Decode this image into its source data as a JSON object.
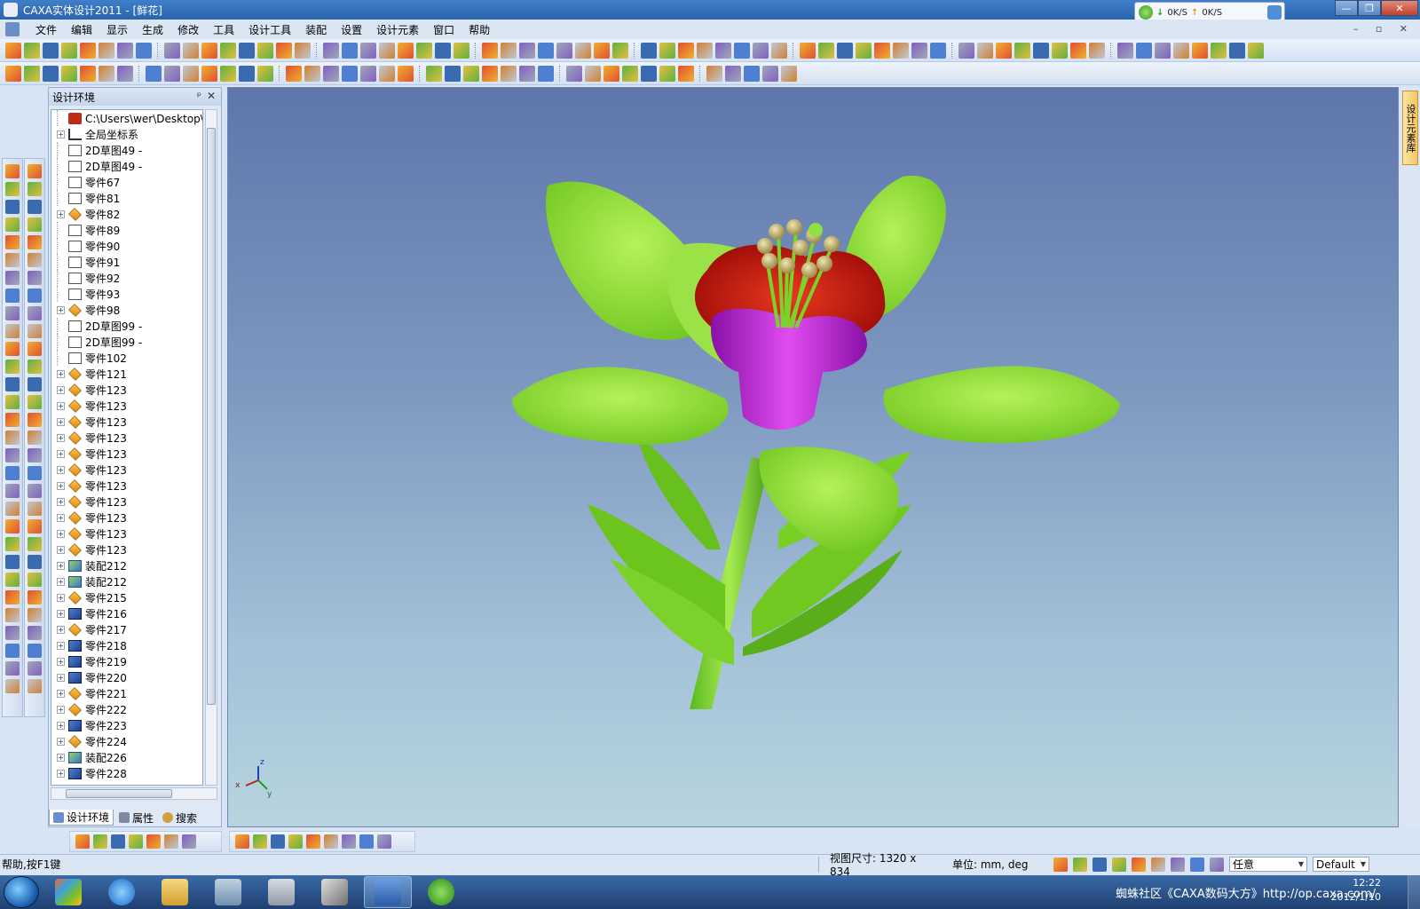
{
  "window": {
    "title": "CAXA实体设计2011 - [鲜花]",
    "controls": [
      "—",
      "❐",
      "✕"
    ]
  },
  "net_meter": {
    "down": "0K/S",
    "up": "0K/S"
  },
  "menu": {
    "items": [
      "文件",
      "编辑",
      "显示",
      "生成",
      "修改",
      "工具",
      "设计工具",
      "装配",
      "设置",
      "设计元素",
      "窗口",
      "帮助"
    ]
  },
  "panel": {
    "title": "设计环境",
    "pin": "ᵖ",
    "close": "✕",
    "tabs": [
      "设计环境",
      "属性",
      "搜索"
    ],
    "tree": [
      {
        "label": "C:\\Users\\wer\\Desktop\\鲜花",
        "icon": "root",
        "expander": false
      },
      {
        "label": "全局坐标系",
        "icon": "axes",
        "expander": true
      },
      {
        "label": "2D草图49 -",
        "icon": "sketch",
        "expander": false
      },
      {
        "label": "2D草图49 -",
        "icon": "sketch",
        "expander": false
      },
      {
        "label": "零件67",
        "icon": "sketch",
        "expander": false
      },
      {
        "label": "零件81",
        "icon": "sketch",
        "expander": false
      },
      {
        "label": "零件82",
        "icon": "part",
        "expander": true
      },
      {
        "label": "零件89",
        "icon": "sketch",
        "expander": false
      },
      {
        "label": "零件90",
        "icon": "sketch",
        "expander": false
      },
      {
        "label": "零件91",
        "icon": "sketch",
        "expander": false
      },
      {
        "label": "零件92",
        "icon": "sketch",
        "expander": false
      },
      {
        "label": "零件93",
        "icon": "sketch",
        "expander": false
      },
      {
        "label": "零件98",
        "icon": "part",
        "expander": true
      },
      {
        "label": "2D草图99 -",
        "icon": "sketch",
        "expander": false
      },
      {
        "label": "2D草图99 -",
        "icon": "sketch",
        "expander": false
      },
      {
        "label": "零件102",
        "icon": "sketch",
        "expander": false
      },
      {
        "label": "零件121",
        "icon": "part",
        "expander": true
      },
      {
        "label": "零件123",
        "icon": "part",
        "expander": true
      },
      {
        "label": "零件123",
        "icon": "part",
        "expander": true
      },
      {
        "label": "零件123",
        "icon": "part",
        "expander": true
      },
      {
        "label": "零件123",
        "icon": "part",
        "expander": true
      },
      {
        "label": "零件123",
        "icon": "part",
        "expander": true
      },
      {
        "label": "零件123",
        "icon": "part",
        "expander": true
      },
      {
        "label": "零件123",
        "icon": "part",
        "expander": true
      },
      {
        "label": "零件123",
        "icon": "part",
        "expander": true
      },
      {
        "label": "零件123",
        "icon": "part",
        "expander": true
      },
      {
        "label": "零件123",
        "icon": "part",
        "expander": true
      },
      {
        "label": "零件123",
        "icon": "part",
        "expander": true
      },
      {
        "label": "装配212",
        "icon": "assy",
        "expander": true
      },
      {
        "label": "装配212",
        "icon": "assy",
        "expander": true
      },
      {
        "label": "零件215",
        "icon": "part",
        "expander": true
      },
      {
        "label": "零件216",
        "icon": "blue",
        "expander": true
      },
      {
        "label": "零件217",
        "icon": "part",
        "expander": true
      },
      {
        "label": "零件218",
        "icon": "blue",
        "expander": true
      },
      {
        "label": "零件219",
        "icon": "blue",
        "expander": true
      },
      {
        "label": "零件220",
        "icon": "blue",
        "expander": true
      },
      {
        "label": "零件221",
        "icon": "part",
        "expander": true
      },
      {
        "label": "零件222",
        "icon": "part",
        "expander": true
      },
      {
        "label": "零件223",
        "icon": "blue",
        "expander": true
      },
      {
        "label": "零件224",
        "icon": "part",
        "expander": true
      },
      {
        "label": "装配226",
        "icon": "assy",
        "expander": true
      },
      {
        "label": "零件228",
        "icon": "blue",
        "expander": true
      }
    ]
  },
  "side_tab": "设计元素库",
  "axes": {
    "x": "x",
    "y": "y",
    "z": "z"
  },
  "status": {
    "help": "帮助,按F1键",
    "view_size": "视图尺寸: 1320 x 834",
    "units": "单位: mm, deg",
    "select_mode": "任意",
    "style": "Default"
  },
  "taskbar": {
    "tray_text": "蜘蛛社区《CAXA数码大方》http://op.caxa.com/",
    "time": "12:22",
    "date": "2012/1/10"
  },
  "colors": {
    "viewport_top": "#5e76ab",
    "viewport_bottom": "#b7d4de",
    "leaf": "#8fdc3a",
    "petal_red": "#cc1a10",
    "cup_purple": "#b01cc8"
  }
}
